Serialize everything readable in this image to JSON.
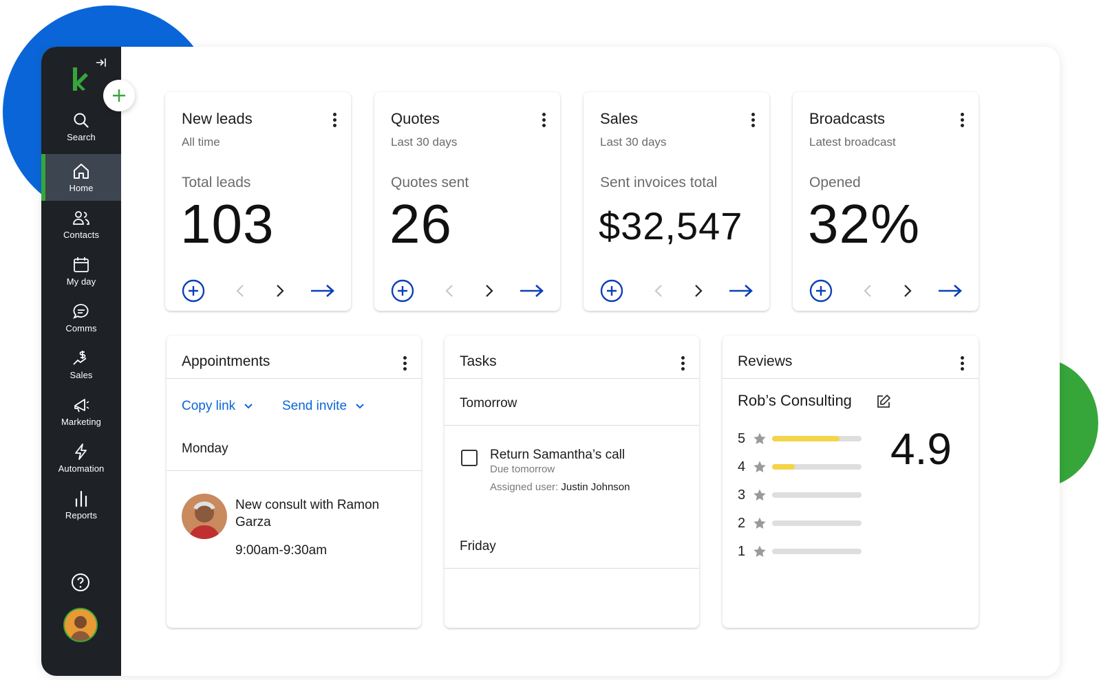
{
  "sidebar": {
    "items": [
      {
        "label": "Search",
        "icon": "search-icon"
      },
      {
        "label": "Home",
        "icon": "home-icon",
        "active": true
      },
      {
        "label": "Contacts",
        "icon": "contacts-icon"
      },
      {
        "label": "My day",
        "icon": "calendar-icon"
      },
      {
        "label": "Comms",
        "icon": "chat-icon"
      },
      {
        "label": "Sales",
        "icon": "sales-icon"
      },
      {
        "label": "Marketing",
        "icon": "megaphone-icon"
      },
      {
        "label": "Automation",
        "icon": "lightning-icon"
      },
      {
        "label": "Reports",
        "icon": "bar-chart-icon"
      }
    ]
  },
  "colors": {
    "brand_green": "#36a63a",
    "brand_blue": "#0a66d8",
    "sidebar": "#1e2126",
    "rating_bar": "#f5d547"
  },
  "metrics": [
    {
      "title": "New leads",
      "subtitle": "All time",
      "label": "Total leads",
      "value": "103"
    },
    {
      "title": "Quotes",
      "subtitle": "Last 30 days",
      "label": "Quotes sent",
      "value": "26"
    },
    {
      "title": "Sales",
      "subtitle": "Last 30 days",
      "label": "Sent invoices total",
      "value": "$32,547"
    },
    {
      "title": "Broadcasts",
      "subtitle": "Latest broadcast",
      "label": "Opened",
      "value": "32%"
    }
  ],
  "appointments": {
    "title": "Appointments",
    "copy_link": "Copy link",
    "send_invite": "Send invite",
    "day": "Monday",
    "event_title": "New consult with Ramon Garza",
    "event_time": "9:00am-9:30am"
  },
  "tasks": {
    "title": "Tasks",
    "group1": "Tomorrow",
    "task_title": "Return Samantha’s call",
    "task_due": "Due tomorrow",
    "assigned_label": "Assigned user:",
    "assigned_user": "Justin Johnson",
    "group2": "Friday"
  },
  "reviews": {
    "title": "Reviews",
    "business": "Rob’s Consulting",
    "average": "4.9",
    "ratings": [
      {
        "stars": "5",
        "fraction": 0.75
      },
      {
        "stars": "4",
        "fraction": 0.25
      },
      {
        "stars": "3",
        "fraction": 0
      },
      {
        "stars": "2",
        "fraction": 0
      },
      {
        "stars": "1",
        "fraction": 0
      }
    ]
  }
}
